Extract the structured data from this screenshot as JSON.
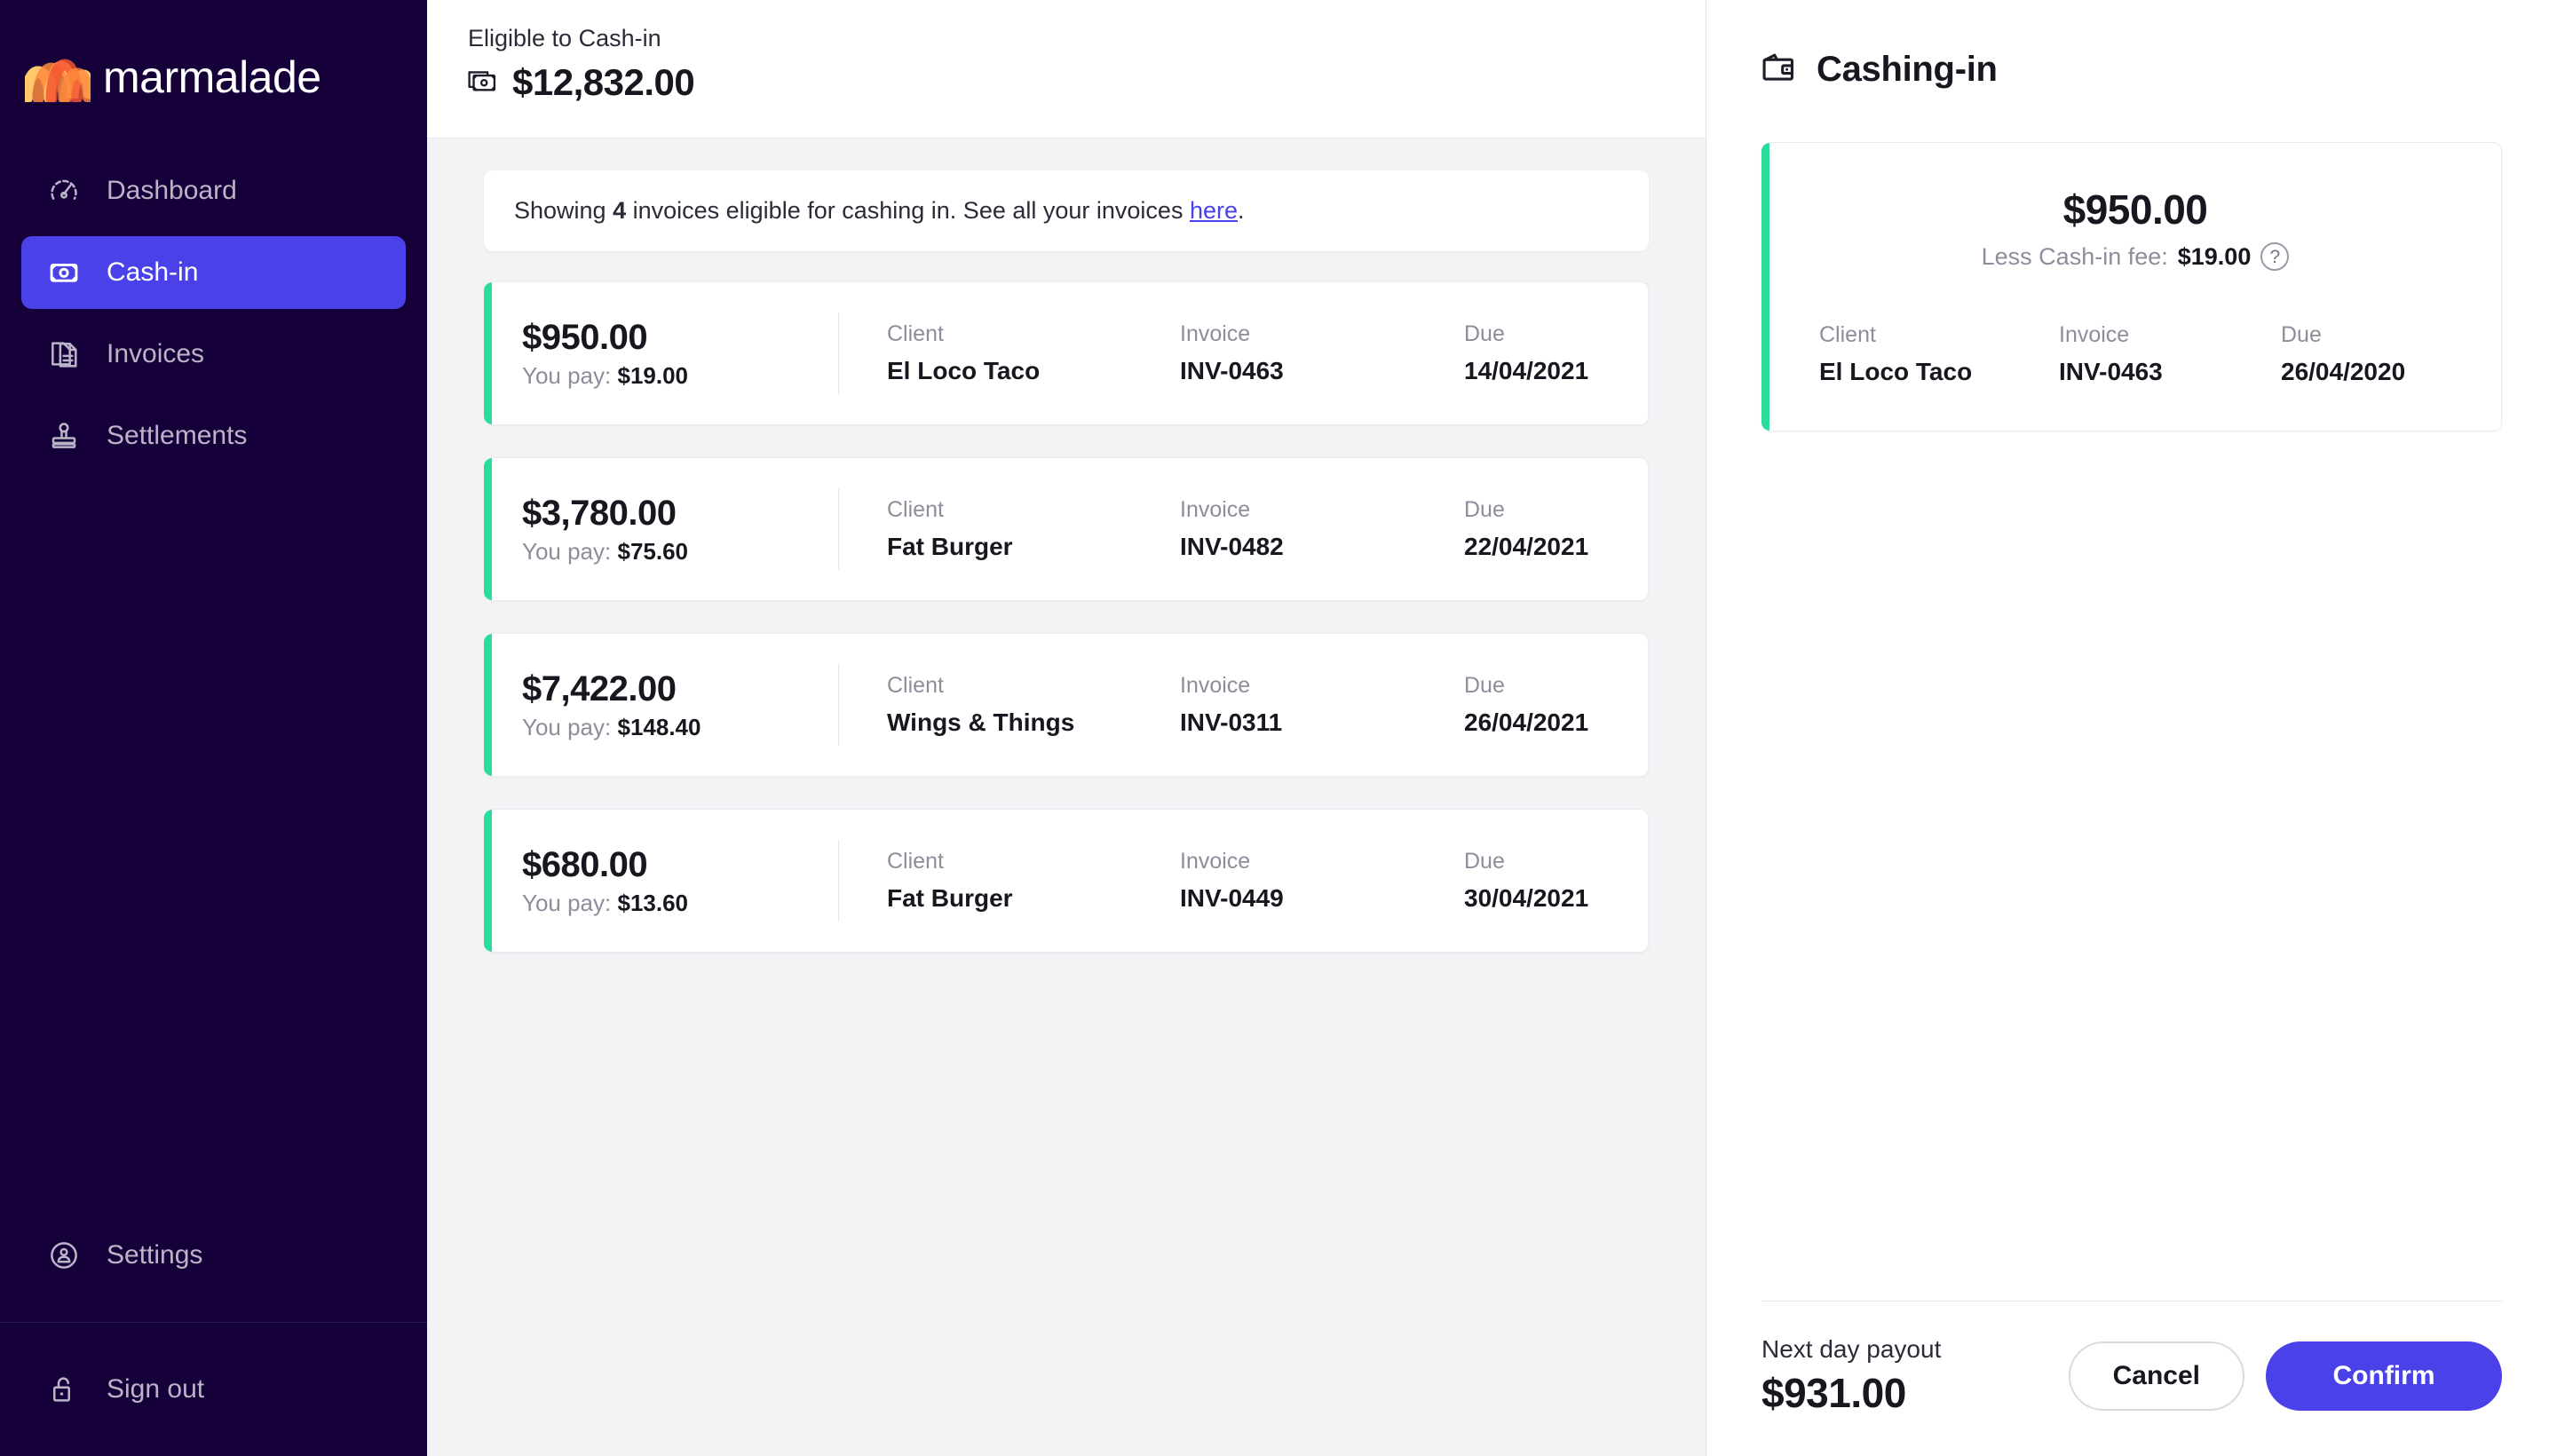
{
  "brand": {
    "name": "marmalade",
    "logo_icon": "marmalade-wave-logo",
    "accent_indigo": "#4A41E8",
    "accent_green": "#2BDD9B",
    "sidebar_bg": "#160039",
    "logo_colors": [
      "#FFC96B",
      "#FF8A3D",
      "#F4552F"
    ]
  },
  "sidebar": {
    "items": [
      {
        "label": "Dashboard",
        "icon": "speedometer-icon",
        "active": false
      },
      {
        "label": "Cash-in",
        "icon": "banknote-icon",
        "active": true
      },
      {
        "label": "Invoices",
        "icon": "documents-icon",
        "active": false
      },
      {
        "label": "Settlements",
        "icon": "stamp-icon",
        "active": false
      }
    ],
    "bottom_items": [
      {
        "label": "Settings",
        "icon": "user-circle-icon"
      },
      {
        "label": "Sign out",
        "icon": "unlocked-padlock-icon"
      }
    ]
  },
  "main": {
    "header": {
      "label": "Eligible to Cash-in",
      "amount": "$12,832.00",
      "icon": "stacked-banknotes-icon"
    },
    "notice": {
      "prefix": "Showing ",
      "count": "4",
      "middle": " invoices eligible for cashing in. See all your invoices ",
      "link": "here",
      "suffix": "."
    },
    "column_labels": {
      "client": "Client",
      "invoice": "Invoice",
      "due": "Due"
    },
    "you_pay_label": "You pay:",
    "invoices": [
      {
        "amount": "$950.00",
        "you_pay": "$19.00",
        "client": "El Loco Taco",
        "invoice": "INV-0463",
        "due": "14/04/2021"
      },
      {
        "amount": "$3,780.00",
        "you_pay": "$75.60",
        "client": "Fat Burger",
        "invoice": "INV-0482",
        "due": "22/04/2021"
      },
      {
        "amount": "$7,422.00",
        "you_pay": "$148.40",
        "client": "Wings & Things",
        "invoice": "INV-0311",
        "due": "26/04/2021"
      },
      {
        "amount": "$680.00",
        "you_pay": "$13.60",
        "client": "Fat Burger",
        "invoice": "INV-0449",
        "due": "30/04/2021"
      }
    ]
  },
  "panel": {
    "title": "Cashing-in",
    "title_icon": "wallet-icon",
    "selected": {
      "amount": "$950.00",
      "fee_label": "Less Cash-in fee:",
      "fee_amount": "$19.00",
      "help_icon": "question-mark-icon",
      "client_label": "Client",
      "client": "El Loco Taco",
      "invoice_label": "Invoice",
      "invoice": "INV-0463",
      "due_label": "Due",
      "due": "26/04/2020"
    },
    "footer": {
      "payout_label": "Next day payout",
      "payout_amount": "$931.00",
      "cancel_label": "Cancel",
      "confirm_label": "Confirm"
    }
  }
}
